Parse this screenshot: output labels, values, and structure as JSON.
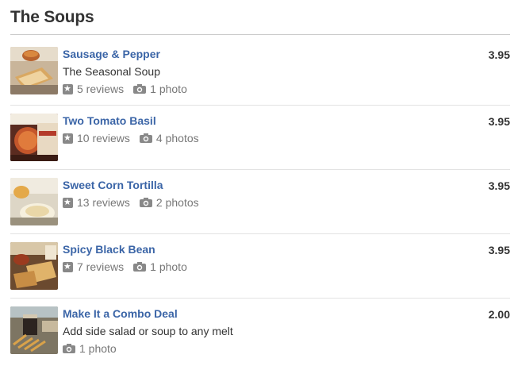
{
  "section": {
    "title": "The Soups"
  },
  "items": [
    {
      "name": "Sausage & Pepper",
      "description": "The Seasonal Soup",
      "price": "3.95",
      "reviews": "5 reviews",
      "photos": "1 photo"
    },
    {
      "name": "Two Tomato Basil",
      "price": "3.95",
      "reviews": "10 reviews",
      "photos": "4 photos"
    },
    {
      "name": "Sweet Corn Tortilla",
      "price": "3.95",
      "reviews": "13 reviews",
      "photos": "2 photos"
    },
    {
      "name": "Spicy Black Bean",
      "price": "3.95",
      "reviews": "7 reviews",
      "photos": "1 photo"
    },
    {
      "name": "Make It a Combo Deal",
      "description": "Add side salad or soup to any melt",
      "price": "2.00",
      "photos": "1 photo"
    }
  ],
  "colors": {
    "link": "#3b65a7",
    "text": "#333333",
    "meta": "#777777",
    "rule": "#cccccc"
  },
  "icons": {
    "reviews": "star-icon",
    "photos": "camera-icon"
  }
}
